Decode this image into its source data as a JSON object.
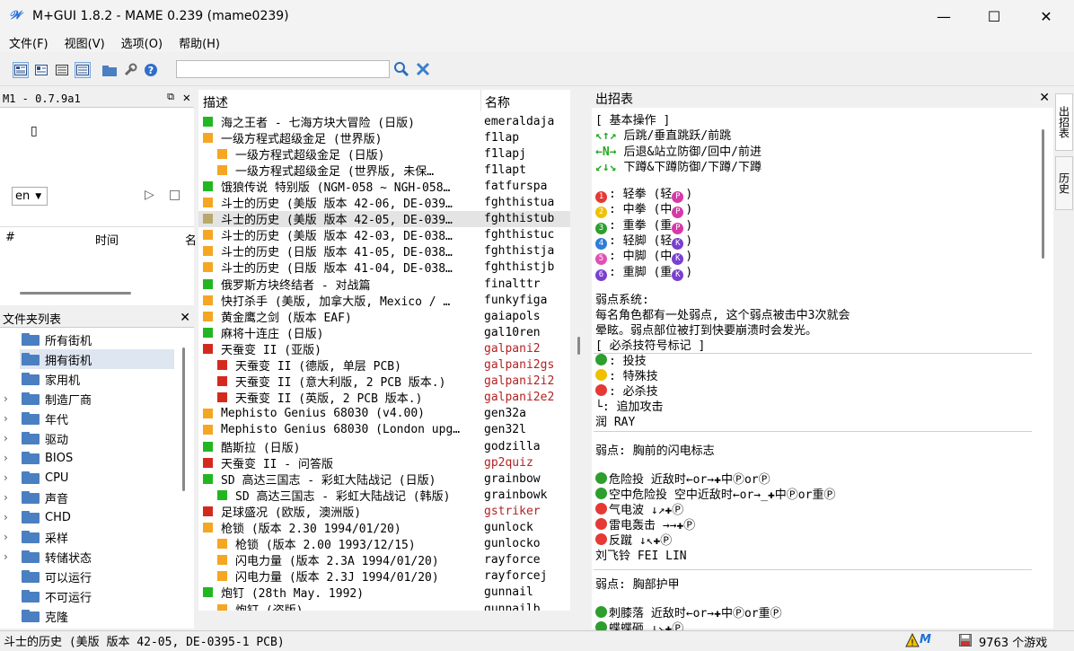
{
  "window": {
    "title": "M+GUI 1.8.2 - MAME 0.239 (mame0239)",
    "app_icon_glyph": "𝒲",
    "minimize_glyph": "—",
    "maximize_glyph": "☐",
    "close_glyph": "✕"
  },
  "menu": [
    "文件(F)",
    "视图(V)",
    "选项(O)",
    "帮助(H)"
  ],
  "toolbar": {
    "icons": [
      "details-view-icon",
      "large-icon-view-icon",
      "list-view-icon",
      "grouped-view-icon",
      "folder-icon",
      "settings-wrench-icon",
      "help-icon"
    ],
    "search_value": "",
    "search_icon": "magnifier-icon",
    "clear_icon": "clear-x-icon"
  },
  "screenshot_panel": {
    "title": "M1 - 0.7.9a1",
    "glyph": "▯",
    "lang_value": "en",
    "play_glyph": "▷",
    "stop_glyph": "□",
    "col_num": "#",
    "col_time": "时间",
    "col_extra": "名"
  },
  "folder_panel": {
    "title": "文件夹列表",
    "items": [
      {
        "label": "所有街机",
        "expandable": false,
        "selected": false
      },
      {
        "label": "拥有街机",
        "expandable": false,
        "selected": true
      },
      {
        "label": "家用机",
        "expandable": false,
        "selected": false
      },
      {
        "label": "制造厂商",
        "expandable": true,
        "selected": false
      },
      {
        "label": "年代",
        "expandable": true,
        "selected": false
      },
      {
        "label": "驱动",
        "expandable": true,
        "selected": false
      },
      {
        "label": "BIOS",
        "expandable": true,
        "selected": false
      },
      {
        "label": "CPU",
        "expandable": true,
        "selected": false
      },
      {
        "label": "声音",
        "expandable": true,
        "selected": false
      },
      {
        "label": "CHD",
        "expandable": true,
        "selected": false
      },
      {
        "label": "采样",
        "expandable": true,
        "selected": false
      },
      {
        "label": "转储状态",
        "expandable": true,
        "selected": false
      },
      {
        "label": "可以运行",
        "expandable": false,
        "selected": false
      },
      {
        "label": "不可运行",
        "expandable": false,
        "selected": false
      },
      {
        "label": "克隆",
        "expandable": false,
        "selected": false
      }
    ],
    "arrow_glyph": "›"
  },
  "game_list": {
    "col_desc": "描述",
    "col_name": "名称",
    "colors": {
      "green": "#22b722",
      "orange": "#f5a623",
      "red": "#d42a1e",
      "olive": "#b9a86a"
    },
    "rows": [
      {
        "desc": "海之王者 - 七海方块大冒险 (日版)",
        "name": "emeraldaja",
        "color": "green",
        "indent": 0,
        "red_text": false,
        "selected": false
      },
      {
        "desc": "一级方程式超级金足 (世界版)",
        "name": "f1lap",
        "color": "orange",
        "indent": 0,
        "red_text": false,
        "selected": false
      },
      {
        "desc": "一级方程式超级金足 (日版)",
        "name": "f1lapj",
        "color": "orange",
        "indent": 1,
        "red_text": false,
        "selected": false
      },
      {
        "desc": "一级方程式超级金足 (世界版, 未保…",
        "name": "f1lapt",
        "color": "orange",
        "indent": 1,
        "red_text": false,
        "selected": false
      },
      {
        "desc": "饿狼传说 特别版 (NGM-058 ~ NGH-058…",
        "name": "fatfurspa",
        "color": "green",
        "indent": 0,
        "red_text": false,
        "selected": false
      },
      {
        "desc": "斗士的历史 (美版 版本 42-06, DE-039…",
        "name": "fghthistua",
        "color": "orange",
        "indent": 0,
        "red_text": false,
        "selected": false
      },
      {
        "desc": "斗士的历史 (美版 版本 42-05, DE-039…",
        "name": "fghthistub",
        "color": "olive",
        "indent": 0,
        "red_text": false,
        "selected": true
      },
      {
        "desc": "斗士的历史 (美版 版本 42-03, DE-038…",
        "name": "fghthistuc",
        "color": "orange",
        "indent": 0,
        "red_text": false,
        "selected": false
      },
      {
        "desc": "斗士的历史 (日版 版本 41-05, DE-038…",
        "name": "fghthistja",
        "color": "orange",
        "indent": 0,
        "red_text": false,
        "selected": false
      },
      {
        "desc": "斗士的历史 (日版 版本 41-04, DE-038…",
        "name": "fghthistjb",
        "color": "orange",
        "indent": 0,
        "red_text": false,
        "selected": false
      },
      {
        "desc": "俄罗斯方块终结者 - 对战篇",
        "name": "finalttr",
        "color": "green",
        "indent": 0,
        "red_text": false,
        "selected": false
      },
      {
        "desc": "快打杀手 (美版, 加拿大版, Mexico / …",
        "name": "funkyfiga",
        "color": "orange",
        "indent": 0,
        "red_text": false,
        "selected": false
      },
      {
        "desc": "黄金鹰之剑 (版本 EAF)",
        "name": "gaiapols",
        "color": "orange",
        "indent": 0,
        "red_text": false,
        "selected": false
      },
      {
        "desc": "麻将十连庄 (日版)",
        "name": "gal10ren",
        "color": "green",
        "indent": 0,
        "red_text": false,
        "selected": false
      },
      {
        "desc": "天蚕变 II (亚版)",
        "name": "galpani2",
        "color": "red",
        "indent": 0,
        "red_text": true,
        "selected": false
      },
      {
        "desc": "天蚕变 II (德版, 单层 PCB)",
        "name": "galpani2gs",
        "color": "red",
        "indent": 1,
        "red_text": true,
        "selected": false
      },
      {
        "desc": "天蚕变 II (意大利版, 2 PCB 版本.)",
        "name": "galpani2i2",
        "color": "red",
        "indent": 1,
        "red_text": true,
        "selected": false
      },
      {
        "desc": "天蚕变 II (英版, 2 PCB 版本.)",
        "name": "galpani2e2",
        "color": "red",
        "indent": 1,
        "red_text": true,
        "selected": false
      },
      {
        "desc": "Mephisto Genius 68030 (v4.00)",
        "name": "gen32a",
        "color": "orange",
        "indent": 0,
        "red_text": false,
        "selected": false
      },
      {
        "desc": "Mephisto Genius 68030 (London upg…",
        "name": "gen32l",
        "color": "orange",
        "indent": 0,
        "red_text": false,
        "selected": false
      },
      {
        "desc": "酷斯拉 (日版)",
        "name": "godzilla",
        "color": "green",
        "indent": 0,
        "red_text": false,
        "selected": false
      },
      {
        "desc": "天蚕变 II - 问答版",
        "name": "gp2quiz",
        "color": "red",
        "indent": 0,
        "red_text": true,
        "selected": false
      },
      {
        "desc": "SD 高达三国志 - 彩虹大陆战记 (日版)",
        "name": "grainbow",
        "color": "green",
        "indent": 0,
        "red_text": false,
        "selected": false
      },
      {
        "desc": "SD 高达三国志 - 彩虹大陆战记 (韩版)",
        "name": "grainbowk",
        "color": "green",
        "indent": 1,
        "red_text": false,
        "selected": false
      },
      {
        "desc": "足球盛况 (欧版, 澳洲版)",
        "name": "gstriker",
        "color": "red",
        "indent": 0,
        "red_text": true,
        "selected": false
      },
      {
        "desc": "枪锁 (版本 2.30 1994/01/20)",
        "name": "gunlock",
        "color": "orange",
        "indent": 0,
        "red_text": false,
        "selected": false
      },
      {
        "desc": "枪锁 (版本 2.00 1993/12/15)",
        "name": "gunlocko",
        "color": "orange",
        "indent": 1,
        "red_text": false,
        "selected": false
      },
      {
        "desc": "闪电力量 (版本 2.3A 1994/01/20)",
        "name": "rayforce",
        "color": "orange",
        "indent": 1,
        "red_text": false,
        "selected": false
      },
      {
        "desc": "闪电力量 (版本 2.3J 1994/01/20)",
        "name": "rayforcej",
        "color": "orange",
        "indent": 1,
        "red_text": false,
        "selected": false
      },
      {
        "desc": "炮钉 (28th May. 1992)",
        "name": "gunnail",
        "color": "green",
        "indent": 0,
        "red_text": false,
        "selected": false
      },
      {
        "desc": "炮钉 (盗版)",
        "name": "gunnailb",
        "color": "orange",
        "indent": 1,
        "red_text": false,
        "selected": false
      }
    ]
  },
  "moves": {
    "title": "出招表",
    "basic_title": "[ 基本操作 ]",
    "arrow_rows": [
      {
        "arrows": "↖↑↗",
        "text": "后跳/垂直跳跃/前跳"
      },
      {
        "arrows": "←N→",
        "text": "后退&站立防御/回中/前进"
      },
      {
        "arrows": "↙↓↘",
        "text": "下蹲&下蹲防御/下蹲/下蹲"
      }
    ],
    "buttons": [
      {
        "num": "1",
        "color": "#e53935",
        "text": ": 轻拳 (轻",
        "tail": "P",
        "tail_color": "#d63aa8"
      },
      {
        "num": "2",
        "color": "#f0c000",
        "text": ": 中拳 (中",
        "tail": "P",
        "tail_color": "#d63aa8"
      },
      {
        "num": "3",
        "color": "#2e9e2e",
        "text": ": 重拳 (重",
        "tail": "P",
        "tail_color": "#d63aa8"
      },
      {
        "num": "4",
        "color": "#2f7dd6",
        "text": ": 轻脚 (轻",
        "tail": "K",
        "tail_color": "#7a3fd0"
      },
      {
        "num": "5",
        "color": "#e04fb4",
        "text": ": 中脚 (中",
        "tail": "K",
        "tail_color": "#7a3fd0"
      },
      {
        "num": "6",
        "color": "#7a3fd0",
        "text": ": 重脚 (重",
        "tail": "K",
        "tail_color": "#7a3fd0"
      }
    ],
    "close_paren": ")",
    "weakpoint_title": "弱点系统:",
    "weakpoint_line1": "每名角色都有一处弱点, 这个弱点被击中3次就会",
    "weakpoint_line2": "晕眩。弱点部位被打到快要崩溃时会发光。",
    "legend_title": "[ 必杀技符号标记 ]",
    "legend": [
      {
        "color": "#2e9e2e",
        "text": ": 投技"
      },
      {
        "color": "#f0c000",
        "text": ": 特殊技"
      },
      {
        "color": "#e53935",
        "text": ": 必杀技"
      },
      {
        "color": "",
        "text": "└: 追加攻击"
      }
    ],
    "char1": "润 RAY",
    "char1_weak": "弱点: 胸前的闪电标志",
    "char1_moves": [
      {
        "color": "#2e9e2e",
        "text": "危险投 近敌时←or→✚中ⓅorⓅ"
      },
      {
        "color": "#2e9e2e",
        "text": "空中危险投 空中近敌时←or→_✚中Ⓟor重Ⓟ"
      },
      {
        "color": "#e53935",
        "text": "气电波 ↓↗✚Ⓟ"
      },
      {
        "color": "#e53935",
        "text": "雷电轰击 →→✚Ⓟ"
      },
      {
        "color": "#e53935",
        "text": "反蹴 ↓↖✚Ⓟ"
      }
    ],
    "char2": "刘飞铃 FEI LIN",
    "char2_weak": "弱点: 胸部护甲",
    "char2_moves": [
      {
        "color": "#2e9e2e",
        "text": "刺膝落 近敌时←or→✚中Ⓟor重Ⓟ"
      },
      {
        "color": "#2e9e2e",
        "text": "蝶蝶砸 ↓↘✚Ⓟ"
      }
    ]
  },
  "side_tabs": [
    "出招表",
    "历史"
  ],
  "status": {
    "left": "斗士的历史 (美版 版本 42-05, DE-0395-1 PCB)",
    "warn_icon": "warning-icon",
    "mame_icon": "mame-logo-icon",
    "disk_icon": "disk-icon",
    "count": "9763 个游戏"
  }
}
